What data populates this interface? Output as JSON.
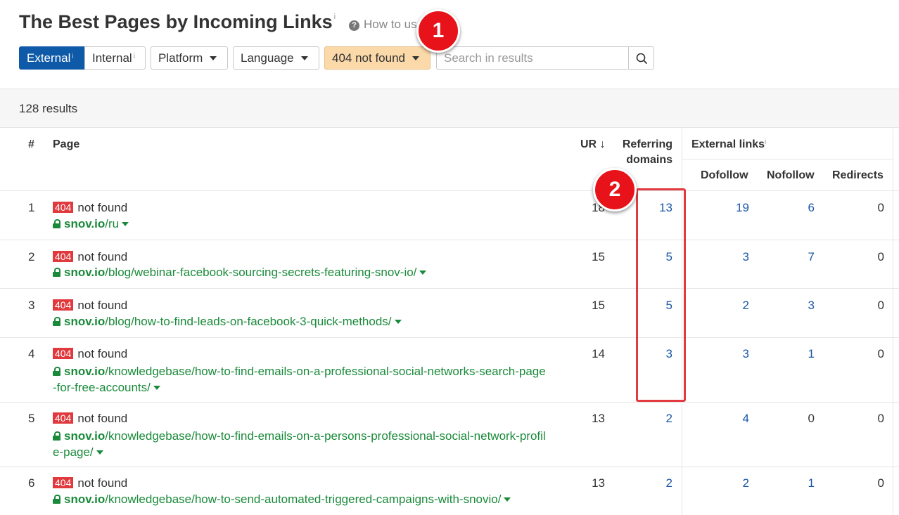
{
  "title": "The Best Pages by Incoming Links",
  "title_info": "i",
  "how_to_use": "How to us",
  "toolbar": {
    "external": "External",
    "external_info": "i",
    "internal": "Internal",
    "internal_info": "i",
    "platform": "Platform",
    "language": "Language",
    "status_filter": "404 not found",
    "search_placeholder": "Search in results"
  },
  "results_count": "128 results",
  "columns": {
    "index": "#",
    "page": "Page",
    "ur": "UR",
    "ur_sort": "↓",
    "referring_line1": "Referring",
    "referring_line2": "domains",
    "external_links": "External links",
    "external_links_info": "i",
    "dofollow": "Dofollow",
    "nofollow": "Nofollow",
    "redirects": "Redirects"
  },
  "rows": [
    {
      "index": "1",
      "badge": "404",
      "status": "not found",
      "domain": "snov.io",
      "path": "/ru",
      "path2": "",
      "ur": "18",
      "referring": "13",
      "dofollow": "19",
      "nofollow": "6",
      "redirects": "0"
    },
    {
      "index": "2",
      "badge": "404",
      "status": "not found",
      "domain": "snov.io",
      "path": "/blog/webinar-facebook-sourcing-secrets-featuring-snov-io/",
      "path2": "",
      "ur": "15",
      "referring": "5",
      "dofollow": "3",
      "nofollow": "7",
      "redirects": "0"
    },
    {
      "index": "3",
      "badge": "404",
      "status": "not found",
      "domain": "snov.io",
      "path": "/blog/how-to-find-leads-on-facebook-3-quick-methods/",
      "path2": "",
      "ur": "15",
      "referring": "5",
      "dofollow": "2",
      "nofollow": "3",
      "redirects": "0"
    },
    {
      "index": "4",
      "badge": "404",
      "status": "not found",
      "domain": "snov.io",
      "path": "/knowledgebase/how-to-find-emails-on-a-professional-social-networks-search-page",
      "path2": "-for-free-accounts/",
      "ur": "14",
      "referring": "3",
      "dofollow": "3",
      "nofollow": "1",
      "redirects": "0"
    },
    {
      "index": "5",
      "badge": "404",
      "status": "not found",
      "domain": "snov.io",
      "path": "/knowledgebase/how-to-find-emails-on-a-persons-professional-social-network-profil",
      "path2": "e-page/",
      "ur": "13",
      "referring": "2",
      "dofollow": "4",
      "nofollow": "0",
      "redirects": "0"
    },
    {
      "index": "6",
      "badge": "404",
      "status": "not found",
      "domain": "snov.io",
      "path": "/knowledgebase/how-to-send-automated-triggered-campaigns-with-snovio/",
      "path2": "",
      "ur": "13",
      "referring": "2",
      "dofollow": "2",
      "nofollow": "1",
      "redirects": "0"
    }
  ],
  "annotations": {
    "marker1": "1",
    "marker2": "2"
  },
  "colors": {
    "accent": "#0f5aa8",
    "filter_active": "#fbd9a9",
    "badge": "#e0393e",
    "url_green": "#1a8a3a",
    "link_blue": "#1a57a6",
    "annotation_red": "#e8131a"
  }
}
